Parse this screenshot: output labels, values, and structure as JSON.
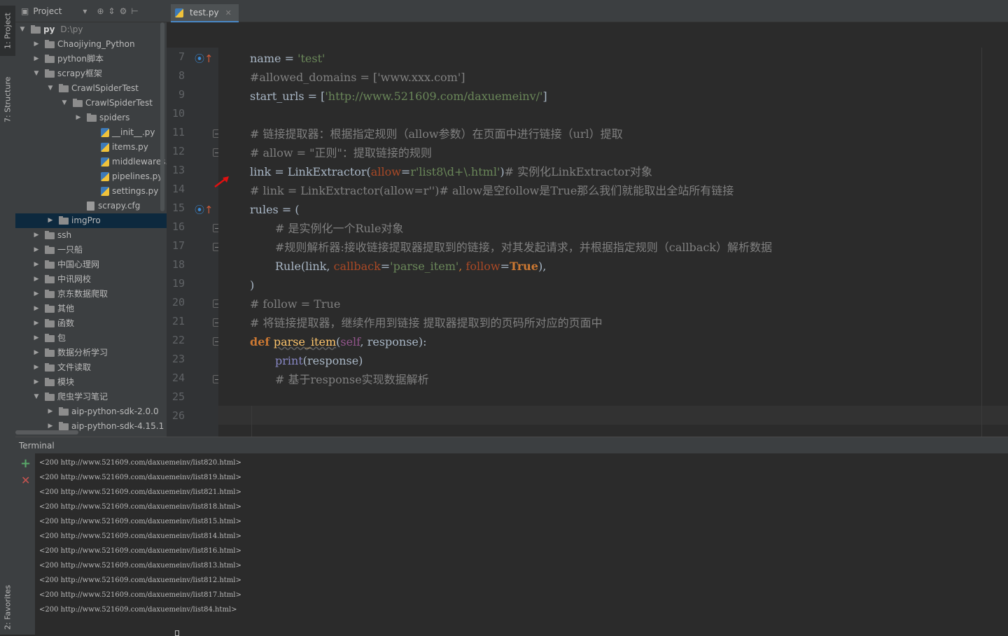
{
  "sidebar_tabs": {
    "project": "1: Project",
    "structure": "7: Structure",
    "favorites": "2: Favorites"
  },
  "project_panel": {
    "header_label": "Project",
    "tree": [
      {
        "label": "py",
        "hint": "D:\\py",
        "kind": "folder",
        "expanded": true
      },
      {
        "label": "Chaojiying_Python",
        "kind": "folder",
        "expanded": false
      },
      {
        "label": "python脚本",
        "kind": "folder",
        "expanded": false
      },
      {
        "label": "scrapy框架",
        "kind": "folder",
        "expanded": true
      },
      {
        "label": "CrawlSpiderTest",
        "kind": "folder",
        "expanded": true
      },
      {
        "label": "CrawlSpiderTest",
        "kind": "folder",
        "expanded": true
      },
      {
        "label": "spiders",
        "kind": "folder",
        "expanded": false
      },
      {
        "label": "__init__.py",
        "kind": "py"
      },
      {
        "label": "items.py",
        "kind": "py"
      },
      {
        "label": "middlewares.py",
        "kind": "py"
      },
      {
        "label": "pipelines.py",
        "kind": "py"
      },
      {
        "label": "settings.py",
        "kind": "py"
      },
      {
        "label": "scrapy.cfg",
        "kind": "cfg"
      },
      {
        "label": "imgPro",
        "kind": "folder",
        "expanded": false,
        "selected": true
      },
      {
        "label": "ssh",
        "kind": "folder",
        "expanded": false
      },
      {
        "label": "一只船",
        "kind": "folder",
        "expanded": false
      },
      {
        "label": "中国心理网",
        "kind": "folder",
        "expanded": false
      },
      {
        "label": "中讯网校",
        "kind": "folder",
        "expanded": false
      },
      {
        "label": "京东数据爬取",
        "kind": "folder",
        "expanded": false
      },
      {
        "label": "其他",
        "kind": "folder",
        "expanded": false
      },
      {
        "label": "函数",
        "kind": "folder",
        "expanded": false
      },
      {
        "label": "包",
        "kind": "folder",
        "expanded": false
      },
      {
        "label": "数据分析学习",
        "kind": "folder",
        "expanded": false
      },
      {
        "label": "文件读取",
        "kind": "folder",
        "expanded": false
      },
      {
        "label": "模块",
        "kind": "folder",
        "expanded": false
      },
      {
        "label": "爬虫学习笔记",
        "kind": "folder",
        "expanded": true
      },
      {
        "label": "aip-python-sdk-2.0.0",
        "kind": "folder",
        "expanded": false
      },
      {
        "label": "aip-python-sdk-4.15.1",
        "kind": "folder",
        "expanded": false
      }
    ]
  },
  "editor": {
    "tab_label": "test.py",
    "line_numbers": [
      "7",
      "8",
      "9",
      "10",
      "11",
      "12",
      "13",
      "14",
      "15",
      "16",
      "17",
      "18",
      "19",
      "20",
      "21",
      "22",
      "23",
      "24",
      "25",
      "26"
    ],
    "code": {
      "l7_name": "name",
      "l7_eq": " = ",
      "l7_val": "'test'",
      "l8": "#allowed_domains = ['www.xxx.com']",
      "l9_a": "start_urls = [",
      "l9_s": "'http://www.521609.com/daxuemeinv/'",
      "l9_b": "]",
      "l11": "# 链接提取器：根据指定规则（allow参数）在页面中进行链接（url）提取",
      "l12": "# allow = \"正则\"：提取链接的规则",
      "l13_a": "link = LinkExtractor(",
      "l13_p": "allow",
      "l13_eq": "=",
      "l13_s": "r'list8\\d+\\.html'",
      "l13_b": ")",
      "l13_c": "# 实例化LinkExtractor对象",
      "l14": "# link = LinkExtractor(allow=r'')# allow是空follow是True那么我们就能取出全站所有链接",
      "l15": "rules = (",
      "l16": "# 是实例化一个Rule对象",
      "l17": "#规则解析器:接收链接提取器提取到的链接，对其发起请求，并根据指定规则（callback）解析数据",
      "l18_a": "Rule(link, ",
      "l18_p1": "callback",
      "l18_eq1": "=",
      "l18_s": "'parse_item'",
      "l18_c1": ", ",
      "l18_p2": "follow",
      "l18_eq2": "=",
      "l18_t": "True",
      "l18_b": "),",
      "l19": ")",
      "l20": "# follow = True",
      "l21": "# 将链接提取器，继续作用到链接 提取器提取到的页码所对应的页面中",
      "l22_def": "def ",
      "l22_fn": "parse_item",
      "l22_a": "(",
      "l22_self": "self",
      "l22_b": ", response):",
      "l23_print": "print",
      "l23_b": "(response)",
      "l24": "# 基于response实现数据解析"
    }
  },
  "terminal": {
    "title": "Terminal",
    "lines": [
      "<200 http://www.521609.com/daxuemeinv/list820.html>",
      "<200 http://www.521609.com/daxuemeinv/list819.html>",
      "<200 http://www.521609.com/daxuemeinv/list821.html>",
      "<200 http://www.521609.com/daxuemeinv/list818.html>",
      "<200 http://www.521609.com/daxuemeinv/list815.html>",
      "<200 http://www.521609.com/daxuemeinv/list814.html>",
      "<200 http://www.521609.com/daxuemeinv/list816.html>",
      "<200 http://www.521609.com/daxuemeinv/list813.html>",
      "<200 http://www.521609.com/daxuemeinv/list812.html>",
      "<200 http://www.521609.com/daxuemeinv/list817.html>",
      "<200 http://www.521609.com/daxuemeinv/list84.html>"
    ]
  }
}
